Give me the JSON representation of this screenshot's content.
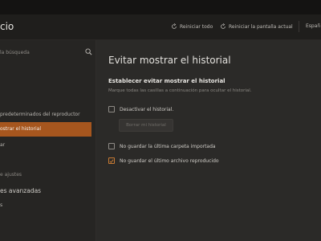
{
  "header": {
    "app_title": "cio",
    "reset_all_label": "Reiniciar todo",
    "reset_screen_label": "Reiniciar la pantalla actual",
    "language_label": "Españ"
  },
  "sidebar": {
    "search_placeholder": "la búsqueda",
    "items": [
      {
        "label": "predeterminados del reproductor"
      },
      {
        "label": "ostrar el historial",
        "active": true
      },
      {
        "label": "ar"
      }
    ],
    "heading": "e ajustes",
    "advanced_label": "es avanzadas",
    "last_item": "s"
  },
  "main": {
    "page_title": "Evitar mostrar el historial",
    "section_title": "Establecer evitar mostrar el historial",
    "section_desc": "Marque todas las casillas a continuación para ocultar el historial.",
    "options": [
      {
        "label": "Desactivar el historial.",
        "checked": false
      },
      {
        "label": "No guardar la última carpeta importada",
        "checked": false
      },
      {
        "label": "No guardar el último archivo reproducido",
        "checked": true
      }
    ],
    "clear_button_label": "Borrar mi historial"
  },
  "colors": {
    "accent": "#a6561e",
    "check": "#c77a33",
    "background": "#2b2a28"
  }
}
